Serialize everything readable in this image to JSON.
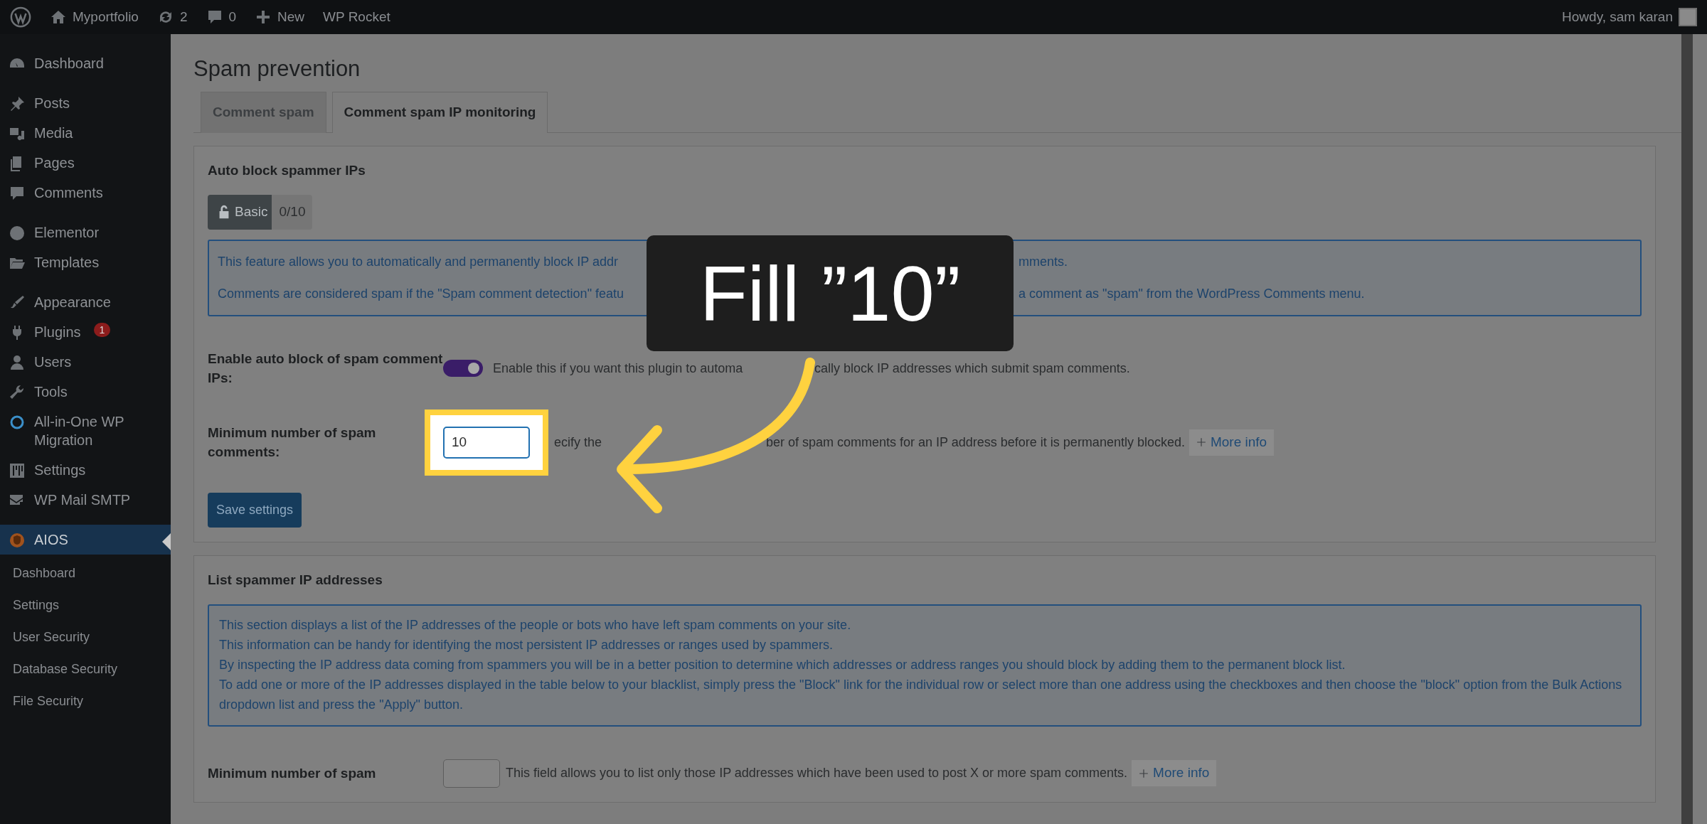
{
  "admin_bar": {
    "site": "Myportfolio",
    "updates": "2",
    "comments": "0",
    "new": "New",
    "plugin": "WP Rocket",
    "greeting": "Howdy, sam karan"
  },
  "sidebar": {
    "groups": [
      [
        {
          "label": "Dashboard",
          "selected": false
        }
      ],
      [
        {
          "label": "Posts",
          "selected": false
        },
        {
          "label": "Media",
          "selected": false
        },
        {
          "label": "Pages",
          "selected": false
        },
        {
          "label": "Comments",
          "selected": false
        }
      ],
      [
        {
          "label": "Elementor",
          "selected": false
        },
        {
          "label": "Templates",
          "selected": false
        }
      ],
      [
        {
          "label": "Appearance",
          "selected": false
        },
        {
          "label": "Plugins",
          "selected": false,
          "badge": "1"
        },
        {
          "label": "Users",
          "selected": false
        },
        {
          "label": "Tools",
          "selected": false
        },
        {
          "label": "All-in-One WP Migration",
          "selected": false
        },
        {
          "label": "Settings",
          "selected": false
        },
        {
          "label": "WP Mail SMTP",
          "selected": false
        }
      ],
      [
        {
          "label": "AIOS",
          "selected": true
        }
      ]
    ],
    "submenu": [
      {
        "label": "Dashboard",
        "selected": false
      },
      {
        "label": "Settings",
        "selected": false
      },
      {
        "label": "User Security",
        "selected": false
      },
      {
        "label": "Database Security",
        "selected": false
      },
      {
        "label": "File Security",
        "selected": false
      }
    ]
  },
  "page_title": "Spam prevention",
  "tabs": [
    {
      "label": "Comment spam",
      "selected": false
    },
    {
      "label": "Comment spam IP monitoring",
      "selected": true
    }
  ],
  "panels": [
    {
      "title": "Auto block spammer IPs",
      "badge": {
        "label": "Basic",
        "score": "0/10"
      },
      "info": [
        [
          "This feature allows you to automatically and permanently block IP addr",
          "mments."
        ],
        [
          "Comments are considered spam if the \"Spam comment detection\" featu",
          "a comment as \"spam\" from the WordPress Comments menu."
        ]
      ],
      "fields": [
        {
          "kind": "toggle",
          "label": "Enable auto block of spam comment IPs:",
          "on": true,
          "description": [
            "Enable this if you want this plugin to automa",
            "cally block IP addresses which submit spam comments."
          ]
        },
        {
          "kind": "number",
          "label": "Minimum number of spam comments:",
          "value": "10",
          "highlighted": true,
          "description": [
            "ecify the",
            "ber of spam comments for an IP address before it is permanently blocked."
          ],
          "more_info": "More info"
        }
      ],
      "button": "Save settings"
    },
    {
      "title": "List spammer IP addresses",
      "info": [
        [
          "This section displays a list of the IP addresses of the people or bots who have left spam comments on your site."
        ],
        [
          "This information can be handy for identifying the most persistent IP addresses or ranges used by spammers."
        ],
        [
          "By inspecting the IP address data coming from spammers you will be in a better position to determine which addresses or address ranges you should block by adding them to the permanent block list."
        ],
        [
          "To add one or more of the IP addresses displayed in the table below to your blacklist, simply press the \"Block\" link for the individual row or select more than one address using the checkboxes and then choose the \"block\" option from the Bulk Actions dropdown list and press the \"Apply\" button."
        ]
      ],
      "fields": [
        {
          "kind": "number",
          "label": "Minimum number of spam",
          "highlighted": false,
          "description": [
            "This field allows you to list only those IP addresses which have been used to post X or more spam comments."
          ],
          "more_info": "More info"
        }
      ]
    }
  ],
  "callout": {
    "text": "Fill ”10”"
  }
}
